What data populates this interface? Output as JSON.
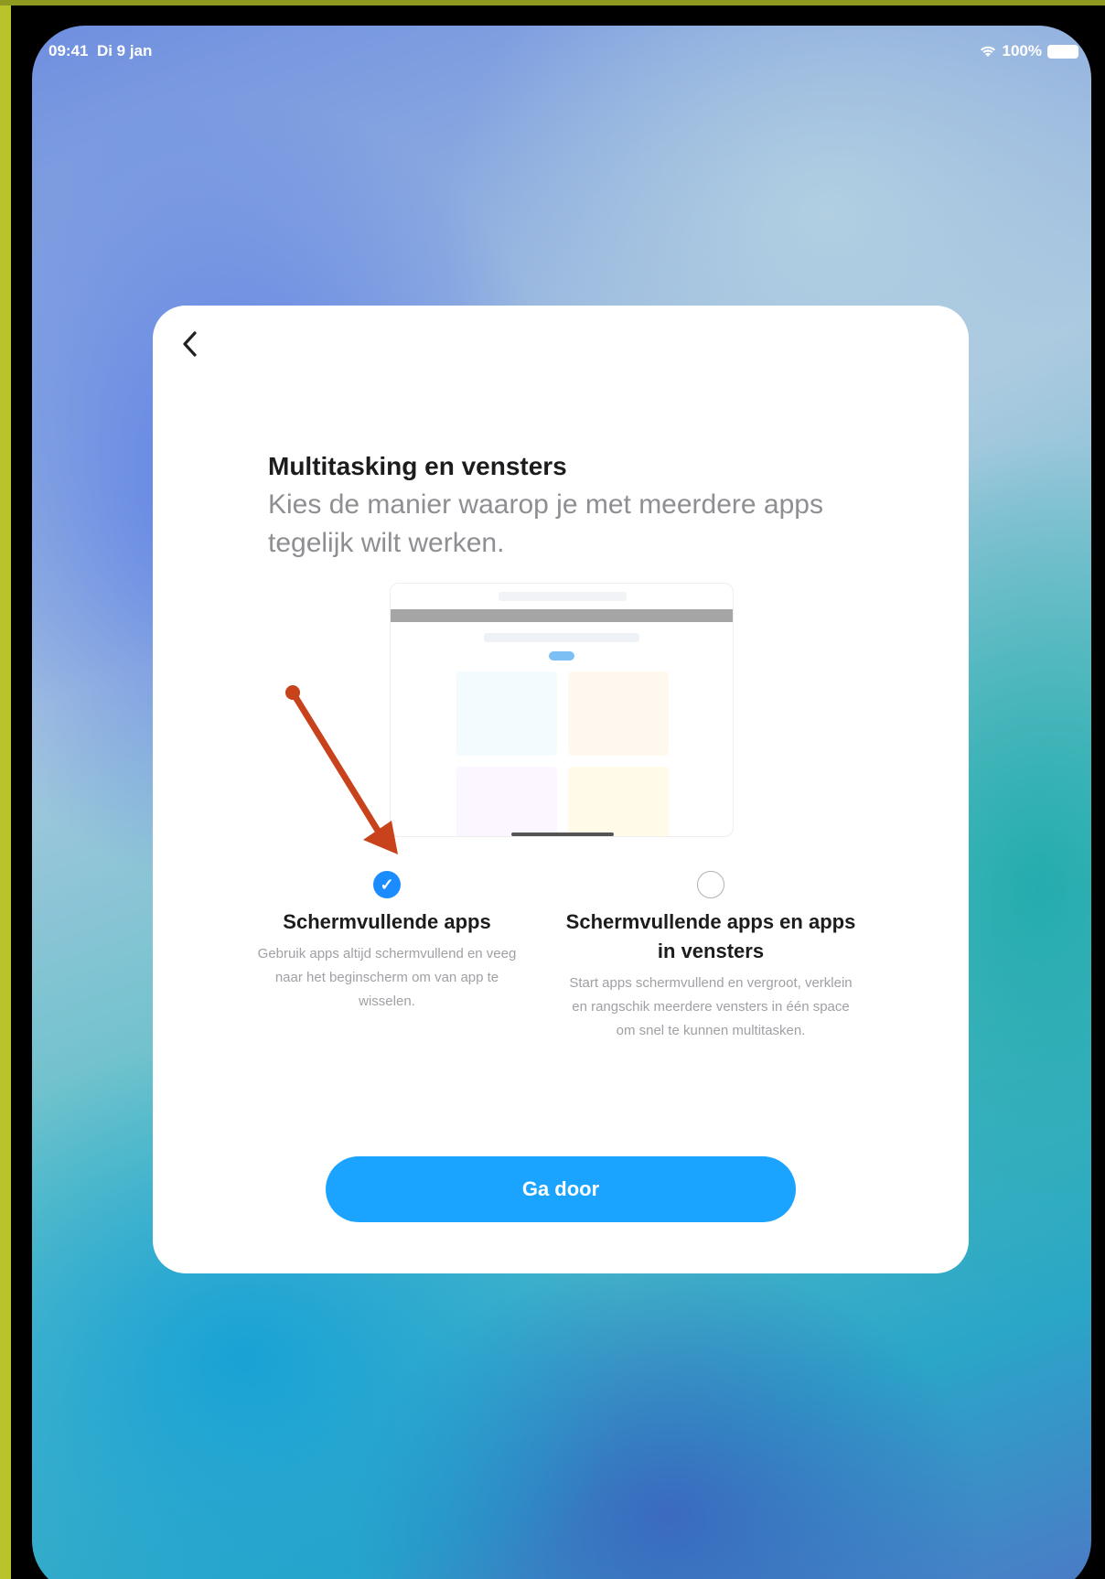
{
  "status_bar": {
    "time": "09:41",
    "date": "Di 9 jan",
    "battery": "100%"
  },
  "card": {
    "back_icon": "chevron-left-icon",
    "title": "Multitasking en vensters",
    "subtitle": "Kies de manier waarop je met meerdere apps tegelijk wilt werken."
  },
  "options": [
    {
      "title": "Schermvullende apps",
      "description": "Gebruik apps altijd schermvullend en veeg naar het beginscherm om van app te wisselen.",
      "selected": true
    },
    {
      "title": "Schermvullende apps en apps in vensters",
      "description": "Start apps schermvullend en vergroot, verklein en rangschik meerdere vensters in één space om snel te kunnen multitasken.",
      "selected": false
    }
  ],
  "continue_button": {
    "label": "Ga door"
  },
  "colors": {
    "accent": "#1aa4ff",
    "annotation_arrow": "#c8431b",
    "card_background": "#ffffff"
  }
}
